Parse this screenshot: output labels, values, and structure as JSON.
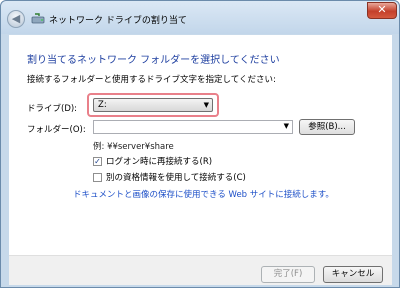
{
  "window": {
    "title": "ネットワーク ドライブの割り当て",
    "close_glyph": "✕",
    "back_glyph": "◀"
  },
  "main": {
    "heading": "割り当てるネットワーク フォルダーを選択してください",
    "instruction": "接続するフォルダーと使用するドライブ文字を指定してください:",
    "drive_label": "ドライブ(D):",
    "drive_value": "Z:",
    "folder_label": "フォルダー(O):",
    "folder_value": "",
    "browse_label": "参照(B)...",
    "example": "例: ¥¥server¥share",
    "reconnect_label": "ログオン時に再接続する(R)",
    "reconnect_checked": true,
    "other_credentials_label": "別の資格情報を使用して接続する(C)",
    "other_credentials_checked": false,
    "link_text": "ドキュメントと画像の保存に使用できる Web サイトに接続します。"
  },
  "footer": {
    "finish_label": "完了(F)",
    "cancel_label": "キャンセル"
  },
  "colors": {
    "heading": "#1e3fa0",
    "link": "#1e50c8",
    "highlight": "#e9808a",
    "close": "#c4402b"
  }
}
